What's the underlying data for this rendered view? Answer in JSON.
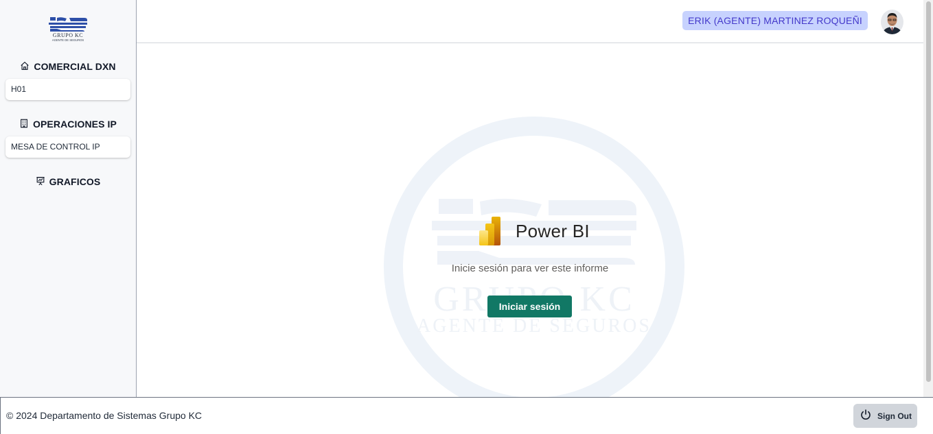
{
  "sidebar": {
    "logo": {
      "line1": "GRUPO KC",
      "line2": "AGENTE DE SEGUROS",
      "accent": "#1e40af"
    },
    "sections": [
      {
        "label": "COMERCIAL DXN",
        "icon": "home-icon",
        "items": [
          "H01"
        ]
      },
      {
        "label": "OPERACIONES IP",
        "icon": "building-icon",
        "items": [
          "MESA DE CONTROL IP"
        ]
      },
      {
        "label": "GRAFICOS",
        "icon": "presentation-chart-icon",
        "items": []
      }
    ]
  },
  "header": {
    "user_name": "ERIK (AGENTE) MARTINEZ ROQUEÑI",
    "badge_bg": "#c7d2fe",
    "badge_color": "#4338ca"
  },
  "main": {
    "powerbi": {
      "title": "Power BI",
      "subtitle": "Inicie sesión para ver este informe",
      "button_label": "Iniciar sesión",
      "button_color": "#117865"
    },
    "watermark": {
      "line1": "GRUPO KC",
      "line2": "AGENTE DE SEGUROS"
    }
  },
  "footer": {
    "copyright": "© 2024 Departamento de Sistemas Grupo KC",
    "signout_label": "Sign Out"
  }
}
